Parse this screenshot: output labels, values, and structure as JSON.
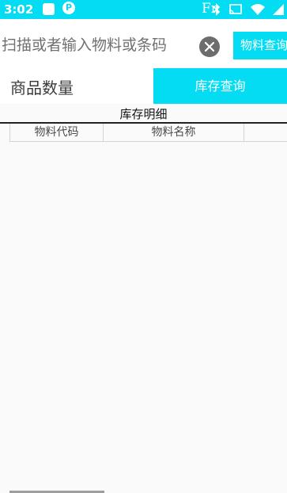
{
  "status_bar": {
    "time": "3:02",
    "fn_label": "Fn",
    "icons": [
      "notification-square-icon",
      "parking-app-icon",
      "bluetooth-icon",
      "cast-icon",
      "wifi-icon",
      "signal-icon"
    ],
    "background": "#03dcf2"
  },
  "search": {
    "placeholder": "扫描或者输入物料或条码",
    "value": "",
    "clear_icon": "close-circle-icon",
    "material_query_label": "物料查询"
  },
  "quantity": {
    "label": "商品数量",
    "inventory_query_label": "库存查询"
  },
  "detail": {
    "title": "库存明细",
    "columns": [
      "物料代码",
      "物料名称",
      ""
    ]
  },
  "colors": {
    "accent": "#03dcf2",
    "background": "#fafafa"
  }
}
